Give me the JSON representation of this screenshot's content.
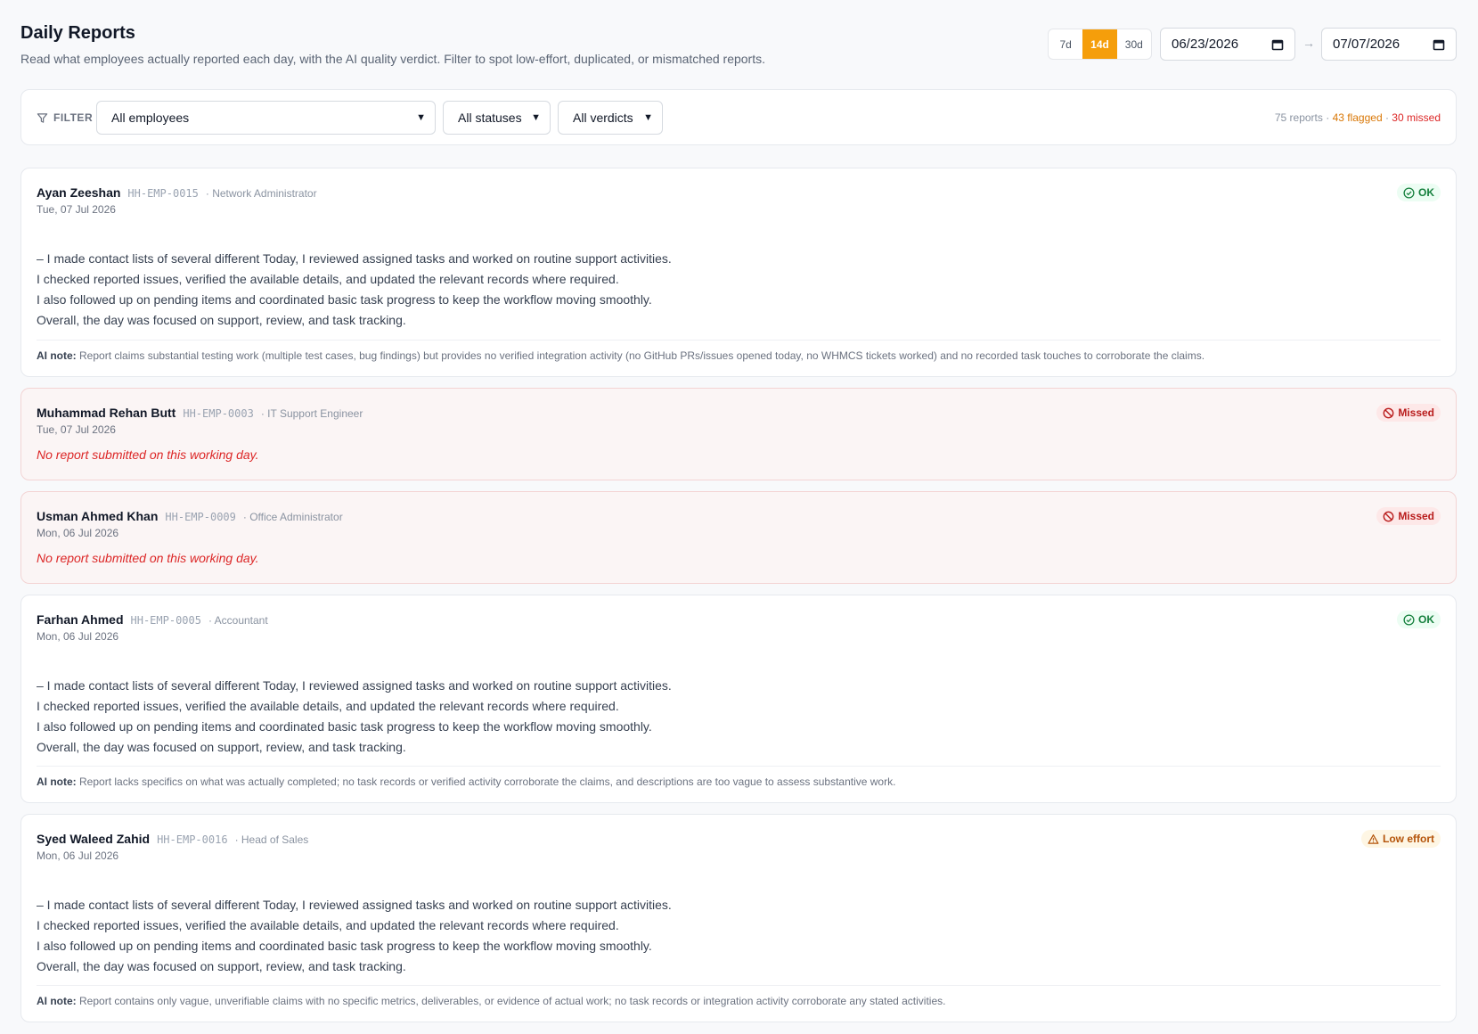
{
  "header": {
    "title": "Daily Reports",
    "subtitle": "Read what employees actually reported each day, with the AI quality verdict. Filter to spot low-effort, duplicated, or mismatched reports."
  },
  "range": {
    "options": [
      "7d",
      "14d",
      "30d"
    ],
    "active": "14d",
    "from": "06/23/2026",
    "arrow": "→",
    "to": "07/07/2026"
  },
  "filter": {
    "label": "FILTER",
    "employees": "All employees",
    "statuses": "All statuses",
    "verdicts": "All verdicts",
    "summary_total": "75 reports",
    "summary_flagged": "43 flagged",
    "summary_missed": "30 missed"
  },
  "colors": {
    "accent": "#f59e0b",
    "ok": "#15803d",
    "missed": "#dc2626",
    "low_effort": "#b45309"
  },
  "ai_note_label": "AI note:",
  "missing_text": "No report submitted on this working day.",
  "reports": [
    {
      "name": "Ayan Zeeshan",
      "id": "HH-EMP-0015",
      "role": "· Network Administrator",
      "date": "Tue, 07 Jul 2026",
      "verdict": "OK",
      "lines": [
        "– I made contact lists of several different Today, I reviewed assigned tasks and worked on routine support activities.",
        "I checked reported issues, verified the available details, and updated the relevant records where required.",
        "I also followed up on pending items and coordinated basic task progress to keep the workflow moving smoothly.",
        "Overall, the day was focused on support, review, and task tracking."
      ],
      "ai_note": "Report claims substantial testing work (multiple test cases, bug findings) but provides no verified integration activity (no GitHub PRs/issues opened today, no WHMCS tickets worked) and no recorded task touches to corroborate the claims."
    },
    {
      "name": "Muhammad Rehan Butt",
      "id": "HH-EMP-0003",
      "role": "· IT Support Engineer",
      "date": "Tue, 07 Jul 2026",
      "verdict": "Missed"
    },
    {
      "name": "Usman Ahmed Khan",
      "id": "HH-EMP-0009",
      "role": "· Office Administrator",
      "date": "Mon, 06 Jul 2026",
      "verdict": "Missed"
    },
    {
      "name": "Farhan Ahmed",
      "id": "HH-EMP-0005",
      "role": "· Accountant",
      "date": "Mon, 06 Jul 2026",
      "verdict": "OK",
      "lines": [
        "– I made contact lists of several different Today, I reviewed assigned tasks and worked on routine support activities.",
        "I checked reported issues, verified the available details, and updated the relevant records where required.",
        "I also followed up on pending items and coordinated basic task progress to keep the workflow moving smoothly.",
        "Overall, the day was focused on support, review, and task tracking."
      ],
      "ai_note": "Report lacks specifics on what was actually completed; no task records or verified activity corroborate the claims, and descriptions are too vague to assess substantive work."
    },
    {
      "name": "Syed Waleed Zahid",
      "id": "HH-EMP-0016",
      "role": "· Head of Sales",
      "date": "Mon, 06 Jul 2026",
      "verdict": "Low effort",
      "lines": [
        "– I made contact lists of several different Today, I reviewed assigned tasks and worked on routine support activities.",
        "I checked reported issues, verified the available details, and updated the relevant records where required.",
        "I also followed up on pending items and coordinated basic task progress to keep the workflow moving smoothly.",
        "Overall, the day was focused on support, review, and task tracking."
      ],
      "ai_note": "Report contains only vague, unverifiable claims with no specific metrics, deliverables, or evidence of actual work; no task records or integration activity corroborate any stated activities."
    }
  ]
}
